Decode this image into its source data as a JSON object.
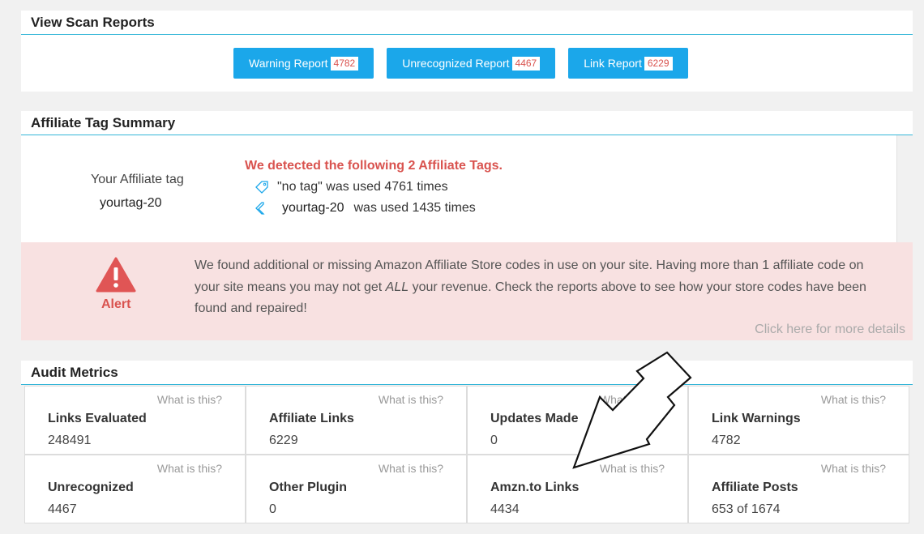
{
  "scan": {
    "title": "View Scan Reports",
    "buttons": [
      {
        "label": "Warning Report",
        "count": "4782"
      },
      {
        "label": "Unrecognized Report",
        "count": "4467"
      },
      {
        "label": "Link Report",
        "count": "6229"
      }
    ]
  },
  "tags": {
    "title": "Affiliate Tag Summary",
    "your_tag_label": "Your Affiliate tag",
    "your_tag_value": "yourtag-20",
    "detected": "We detected the following 2 Affiliate Tags.",
    "line1": "\"no tag\" was used 4761 times",
    "line2_tag": "yourtag-20",
    "line2_rest": "was used 1435 times"
  },
  "alert": {
    "label": "Alert",
    "text_a": "We found additional or missing Amazon Affiliate Store codes in use on your site. Having more than 1 affiliate code on your site means you may not get ",
    "text_em": "ALL",
    "text_b": " your revenue. Check the reports above to see how your store codes have been found and repaired!",
    "more": "Click here for more details"
  },
  "metrics": {
    "title": "Audit Metrics",
    "what_label": "What is this?",
    "cells": [
      {
        "name": "Links Evaluated",
        "value": "248491"
      },
      {
        "name": "Affiliate Links",
        "value": "6229"
      },
      {
        "name": "Updates Made",
        "value": "0"
      },
      {
        "name": "Link Warnings",
        "value": "4782"
      },
      {
        "name": "Unrecognized",
        "value": "4467"
      },
      {
        "name": "Other Plugin",
        "value": "0"
      },
      {
        "name": "Amzn.to Links",
        "value": "4434"
      },
      {
        "name": "Affiliate Posts",
        "value": "653 of 1674"
      }
    ]
  },
  "colors": {
    "accent": "#1ba7ea",
    "alert_red": "#d9534f",
    "alert_bg": "#f8e1e1",
    "divider": "#35b6d8"
  },
  "icons": [
    "tag-icon",
    "warning-triangle-icon",
    "arrow-annotation-icon"
  ]
}
